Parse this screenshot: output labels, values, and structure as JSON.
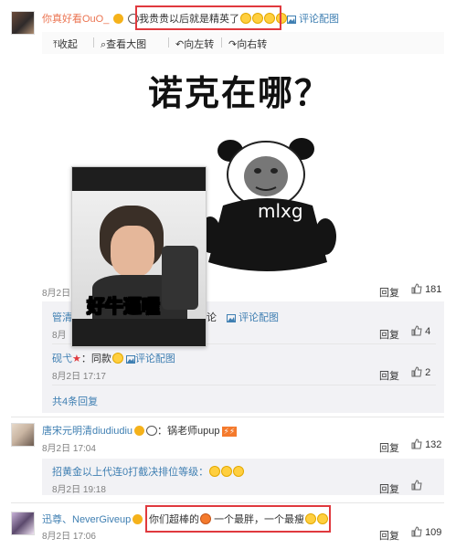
{
  "comment1": {
    "user": "你真好看OuO_",
    "text": "我贵贵以后就是精英了",
    "reply_link": "评论配图"
  },
  "toolbar": {
    "collapse": "收起",
    "view_large": "查看大图",
    "rotate_left": "向左转",
    "rotate_right": "向右转"
  },
  "image": {
    "headline": "诺克在哪？",
    "panda_label": "mlxg",
    "thumb_caption": "好牛逼喔"
  },
  "comment1_footer": {
    "date": "8月2日",
    "reply_label": "回复",
    "likes": "181"
  },
  "subreplies": [
    {
      "user": "管清",
      "date": "8月",
      "tail": "论",
      "link": "评论配图",
      "reply_label": "回复",
      "likes": "4"
    },
    {
      "user": "砚弋",
      "text": "：同款",
      "link": "评论配图",
      "date": "8月2日 17:17",
      "reply_label": "回复",
      "likes": "2"
    }
  ],
  "more_replies": "共4条回复",
  "comment2": {
    "user": "唐宋元明清diudiudiu",
    "text": "：锅老师upup",
    "date": "8月2日 17:04",
    "reply_label": "回复",
    "likes": "132"
  },
  "comment2_sub": {
    "text": "招黄金以上代连0打截决排位等级：",
    "date": "8月2日 19:18",
    "reply_label": "回复"
  },
  "comment3": {
    "user": "迅尊、NeverGiveup",
    "text": "你们超棒的",
    "text2": "一个最胖，一个最瘦",
    "date": "8月2日 17:06",
    "reply_label": "回复",
    "likes": "109"
  },
  "colors": {
    "username": "#eb7350",
    "link": "#3f7fb2",
    "highlight": "#e0393e"
  }
}
